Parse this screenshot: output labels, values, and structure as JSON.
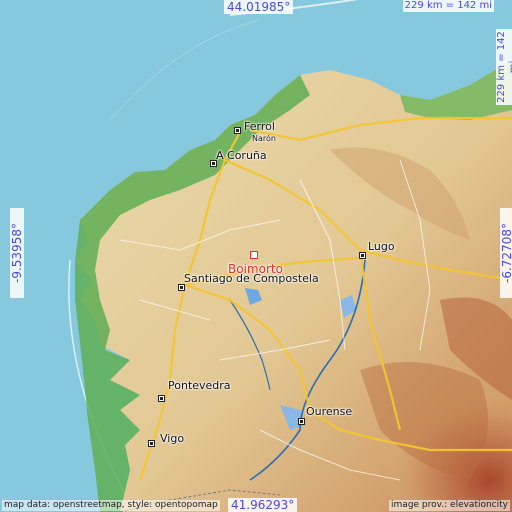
{
  "map": {
    "colors": {
      "sea": "#86c8dd",
      "lowland": "#4fa64a",
      "plain": "#e8d9a6",
      "hill": "#d8b47a",
      "mountain": "#b5613a",
      "road": "#f4c531",
      "river": "#2a6fb0"
    },
    "coords": {
      "top": "44.01985°",
      "bottom": "41.96293°",
      "left": "-9.53958°",
      "right": "-6.72708°"
    },
    "scale": {
      "horizontal": "229 km = 142 mi",
      "vertical": "229 km = 142 mi"
    },
    "target": {
      "name": "Boimorto"
    },
    "cities": [
      {
        "id": "ferrol",
        "name": "Ferrol"
      },
      {
        "id": "naron",
        "name": "Narón"
      },
      {
        "id": "acoruna",
        "name": "A Coruña"
      },
      {
        "id": "santiago",
        "name": "Santiago de Compostela"
      },
      {
        "id": "lugo",
        "name": "Lugo"
      },
      {
        "id": "pontevedra",
        "name": "Pontevedra"
      },
      {
        "id": "ourense",
        "name": "Ourense"
      },
      {
        "id": "vigo",
        "name": "Vigo"
      }
    ],
    "attribution": {
      "left": "map data: openstreetmap, style: opentopomap",
      "right": "image prov.: elevationcity"
    }
  }
}
